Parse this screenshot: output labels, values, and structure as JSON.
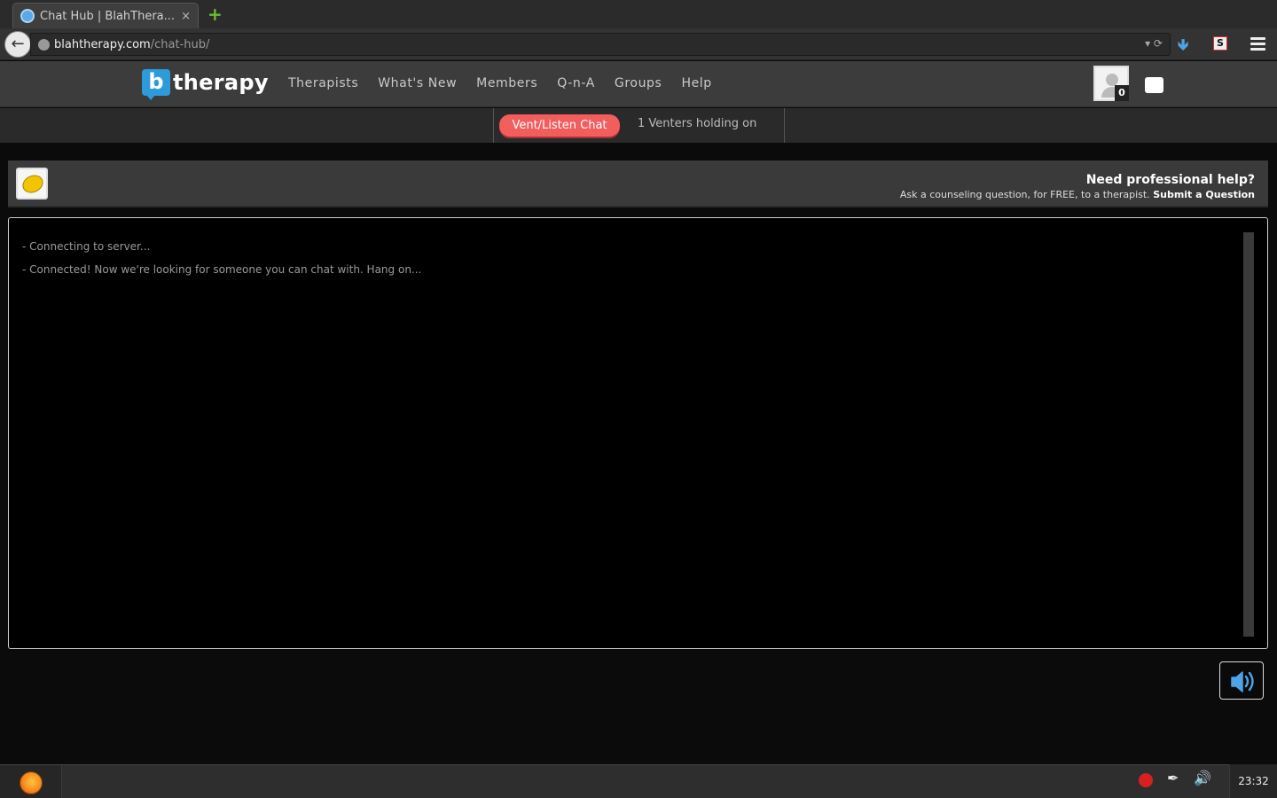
{
  "browser": {
    "tab_title": "Chat Hub | BlahThera...",
    "tab_close": "×",
    "new_tab": "+",
    "url_host": "blahtherapy.com",
    "url_path": "/chat-hub/"
  },
  "site": {
    "logo_letter": "b",
    "logo_text": "therapy",
    "nav": [
      "Therapists",
      "What's New",
      "Members",
      "Q-n-A",
      "Groups",
      "Help"
    ],
    "notification_count": "0"
  },
  "subbar": {
    "button_label": "Vent/Listen Chat",
    "status_text": "1 Venters holding on"
  },
  "help": {
    "title": "Need professional help?",
    "subtitle": "Ask a counseling question, for FREE, to a therapist.",
    "link": "Submit a Question"
  },
  "chat": {
    "lines": [
      "- Connecting to server...",
      "- Connected! Now we're looking for someone you can chat with. Hang on..."
    ]
  },
  "taskbar": {
    "clock": "23:32"
  },
  "colors": {
    "accent_red": "#f25d5d",
    "logo_blue": "#2d9ad9",
    "sound_blue": "#4ea3e6"
  }
}
